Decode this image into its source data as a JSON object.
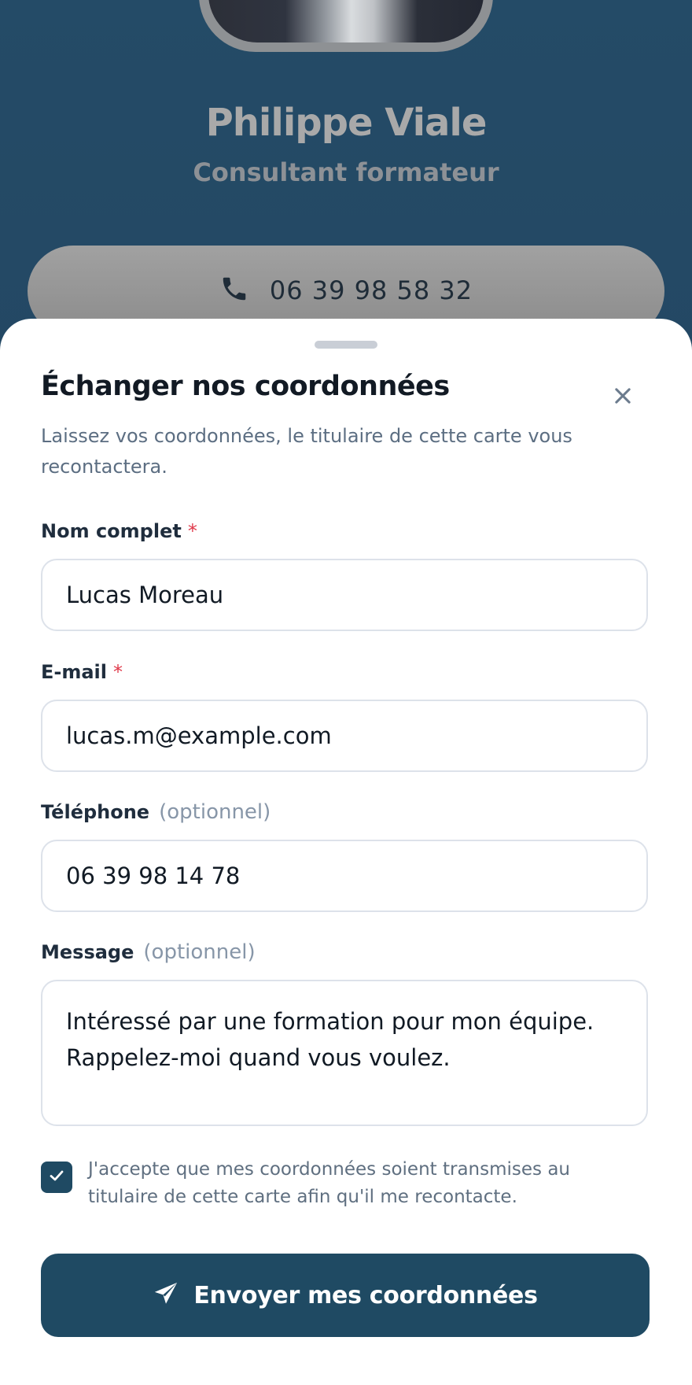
{
  "profile": {
    "name": "Philippe Viale",
    "role": "Consultant formateur",
    "phone": "06 39 98 58 32"
  },
  "sheet": {
    "title": "Échanger nos coordonnées",
    "subtitle": "Laissez vos coordonnées, le titulaire de cette carte vous recontactera.",
    "fields": {
      "name": {
        "label": "Nom complet",
        "required_mark": "*",
        "value": "Lucas Moreau"
      },
      "email": {
        "label": "E-mail",
        "required_mark": "*",
        "value": "lucas.m@example.com"
      },
      "phone": {
        "label": "Téléphone",
        "optional_text": "(optionnel)",
        "value": "06 39 98 14 78"
      },
      "message": {
        "label": "Message",
        "optional_text": "(optionnel)",
        "value": "Intéressé par une formation pour mon équipe. Rappelez-moi quand vous voulez."
      }
    },
    "consent": {
      "checked": true,
      "text": "J'accepte que mes coordonnées soient transmises au titulaire de cette carte afin qu'il me recontacte."
    },
    "submit_label": "Envoyer mes coordonnées"
  },
  "icons": {
    "phone": "phone-icon",
    "close": "close-icon",
    "check": "checkmark-icon",
    "send": "paper-plane-icon"
  },
  "colors": {
    "brand": "#1f4a63",
    "required": "#e0394a",
    "backdrop": "#2a5676"
  }
}
